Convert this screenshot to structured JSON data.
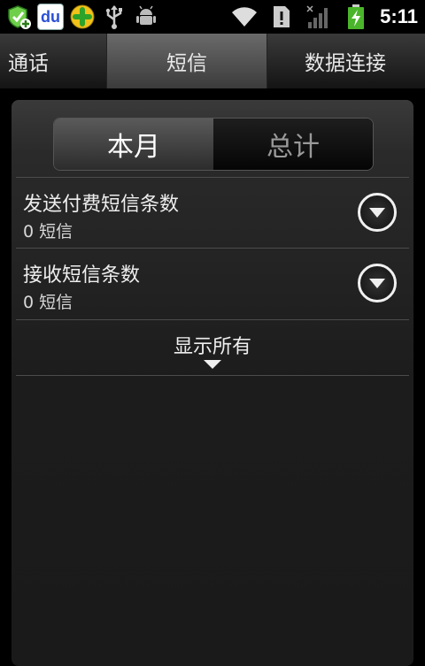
{
  "status_bar": {
    "icons": [
      "shield-plus-icon",
      "du-icon",
      "green-plus-icon",
      "usb-icon",
      "android-debug-icon",
      "wifi-icon",
      "sd-alert-icon",
      "signal-icon",
      "battery-charging-icon"
    ],
    "du_text": "du",
    "time": "5:11"
  },
  "tabs": [
    {
      "label": "通话",
      "active": false
    },
    {
      "label": "短信",
      "active": true
    },
    {
      "label": "数据连接",
      "active": false
    }
  ],
  "segment": {
    "month": "本月",
    "total": "总计",
    "selected": "本月"
  },
  "rows": [
    {
      "title": "发送付费短信条数",
      "value": "0 短信"
    },
    {
      "title": "接收短信条数",
      "value": "0 短信"
    }
  ],
  "show_all": "显示所有",
  "colors": {
    "background": "#000000",
    "panel": "#2a2a2a",
    "active_tab": "#5a5a5a"
  }
}
